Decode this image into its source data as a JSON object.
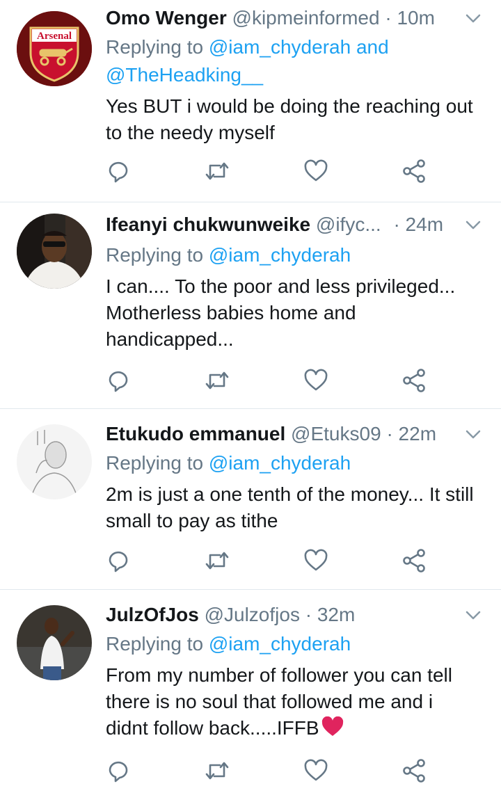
{
  "colors": {
    "link": "#1da1f2",
    "muted": "#657786",
    "text": "#14171a",
    "divider": "#e1e8ed",
    "heart": "#e0245e"
  },
  "tweets": [
    {
      "name": "Omo Wenger",
      "handle": "@kipmeinformed",
      "sep": "·",
      "time": "10m",
      "reply_prefix": "Replying to",
      "reply_users": "@iam_chyderah and @TheHeadking__",
      "text": "Yes BUT i would be doing the reaching out to the needy myself",
      "avatar_icon": "arsenal-crest-avatar",
      "avatar_text": "Arsenal"
    },
    {
      "name": "Ifeanyi chukwunweike",
      "handle": "@ifyc...",
      "sep": "·",
      "time": "24m",
      "reply_prefix": "Replying to",
      "reply_users": "@iam_chyderah",
      "text": "I can.... To the poor and less privileged... Motherless babies home and handicapped...",
      "avatar_icon": "user-photo-avatar"
    },
    {
      "name": "Etukudo emmanuel",
      "handle": "@Etuks09",
      "sep": "·",
      "time": "22m",
      "reply_prefix": "Replying to",
      "reply_users": "@iam_chyderah",
      "text": "2m is just a one tenth of the money... It still small to pay as tithe",
      "avatar_icon": "user-sketch-avatar"
    },
    {
      "name": "JulzOfJos",
      "handle": "@Julzofjos",
      "sep": "·",
      "time": "32m",
      "reply_prefix": "Replying to",
      "reply_users": "@iam_chyderah",
      "text": "From my number of follower you can tell there is no soul that followed me and i didnt follow back.....IFFB",
      "avatar_icon": "user-photo-avatar"
    }
  ],
  "action_icons": [
    "reply-icon",
    "retweet-icon",
    "like-icon",
    "share-icon"
  ]
}
